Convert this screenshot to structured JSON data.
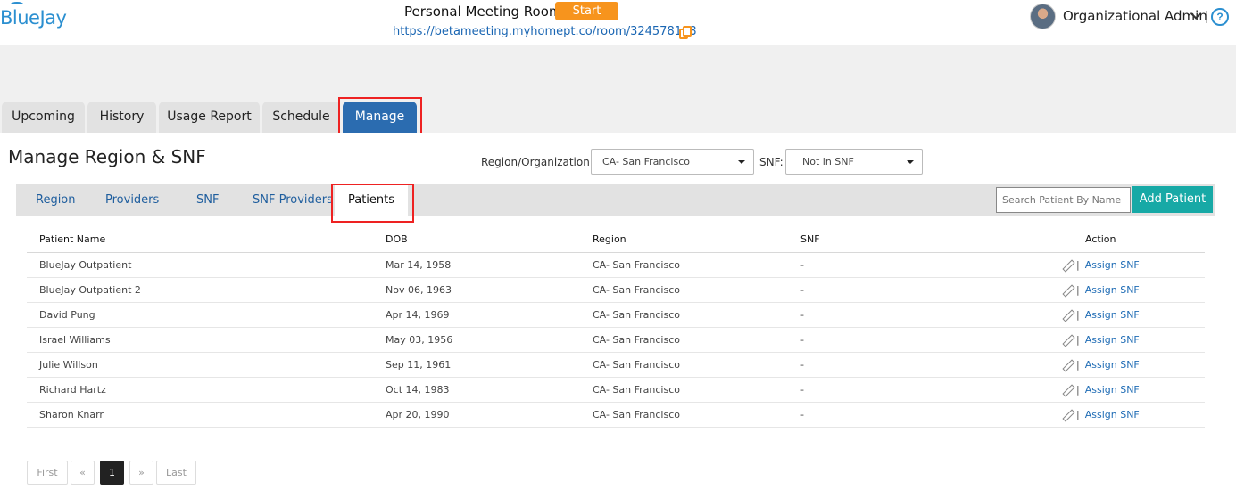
{
  "header": {
    "logo": "BlueJay",
    "meeting_label": "Personal Meeting Room:",
    "start_label": "Start",
    "room_url": "https://betameeting.myhomept.co/room/324578198",
    "user_name": "Organizational Admin",
    "separator": "|",
    "help_glyph": "?"
  },
  "main_tabs": [
    {
      "label": "Upcoming"
    },
    {
      "label": "History"
    },
    {
      "label": "Usage Report"
    },
    {
      "label": "Schedule"
    },
    {
      "label": "Manage"
    }
  ],
  "page": {
    "title": "Manage Region & SNF",
    "region_label": "Region/Organization:",
    "region_value": "CA- San Francisco",
    "snf_label": "SNF:",
    "snf_value": "Not in SNF"
  },
  "sub_tabs": [
    {
      "label": "Region"
    },
    {
      "label": "Providers"
    },
    {
      "label": "SNF"
    },
    {
      "label": "SNF Providers"
    },
    {
      "label": "Patients"
    }
  ],
  "search": {
    "placeholder": "Search Patient By Name"
  },
  "add_patient_label": "Add Patient",
  "table": {
    "headers": {
      "name": "Patient Name",
      "dob": "DOB",
      "region": "Region",
      "snf": "SNF",
      "action": "Action"
    },
    "action_separator": "|",
    "action_label": "Assign SNF",
    "rows": [
      {
        "name": "BlueJay Outpatient",
        "dob": "Mar 14, 1958",
        "region": "CA- San Francisco",
        "snf": "-"
      },
      {
        "name": "BlueJay Outpatient 2",
        "dob": "Nov 06, 1963",
        "region": "CA- San Francisco",
        "snf": "-"
      },
      {
        "name": "David Pung",
        "dob": "Apr 14, 1969",
        "region": "CA- San Francisco",
        "snf": "-"
      },
      {
        "name": "Israel Williams",
        "dob": "May 03, 1956",
        "region": "CA- San Francisco",
        "snf": "-"
      },
      {
        "name": "Julie Willson",
        "dob": "Sep 11, 1961",
        "region": "CA- San Francisco",
        "snf": "-"
      },
      {
        "name": "Richard Hartz",
        "dob": "Oct 14, 1983",
        "region": "CA- San Francisco",
        "snf": "-"
      },
      {
        "name": "Sharon Knarr",
        "dob": "Apr 20, 1990",
        "region": "CA- San Francisco",
        "snf": "-"
      }
    ]
  },
  "pagination": {
    "first": "First",
    "prev": "«",
    "current": "1",
    "next": "»",
    "last": "Last"
  },
  "colors": {
    "brand": "#2b8fd0",
    "active_tab": "#2b6cb0",
    "start": "#f7941d",
    "add_button": "#17a9a6",
    "highlight": "#ee2222"
  }
}
